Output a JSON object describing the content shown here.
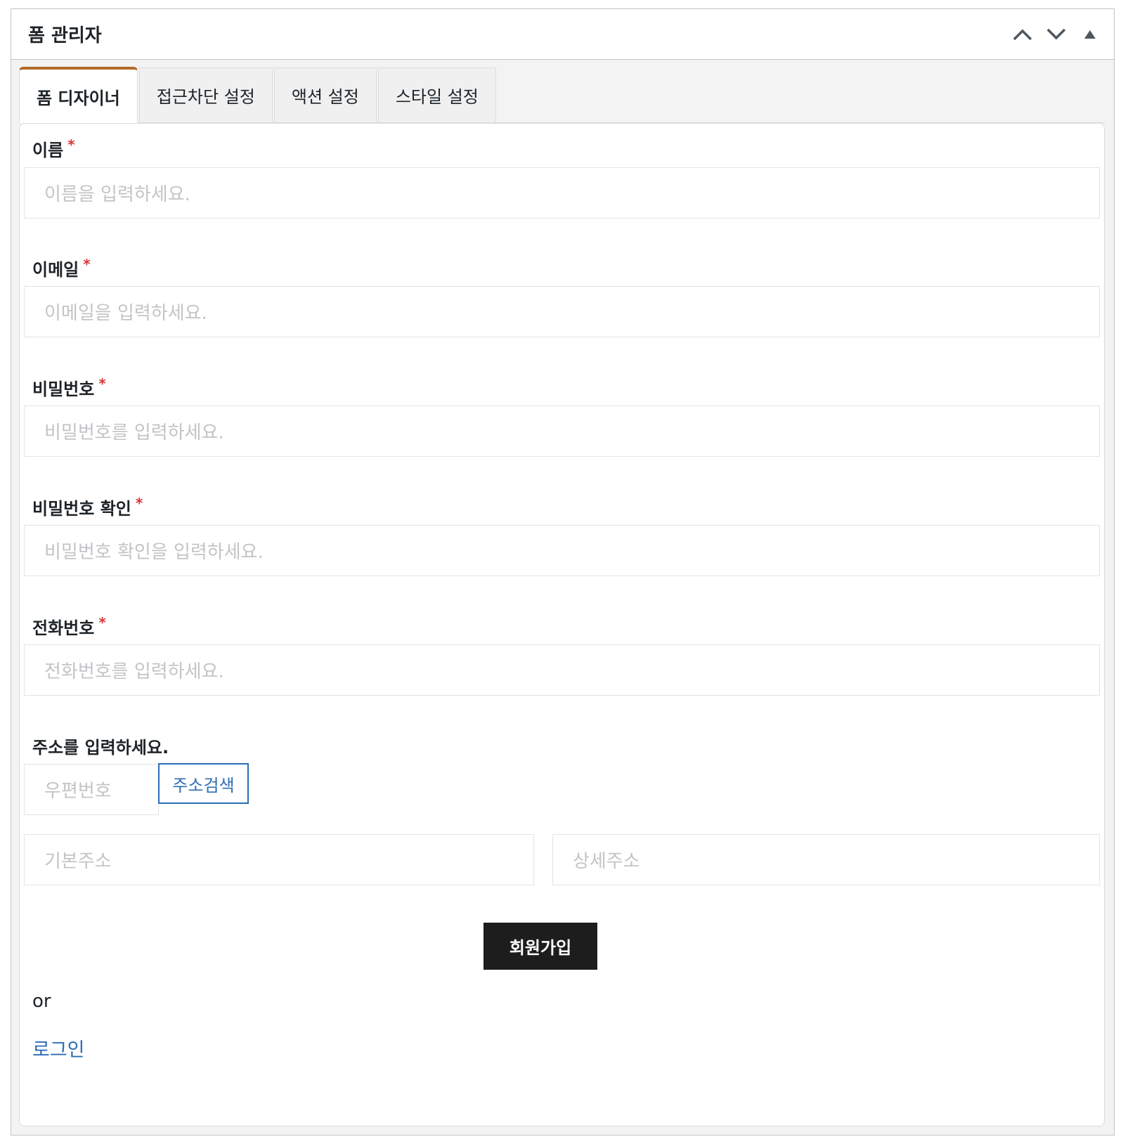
{
  "panel": {
    "title": "폼 관리자",
    "controls": [
      "chevron-up-icon",
      "chevron-down-icon",
      "triangle-up-icon"
    ]
  },
  "tabs": [
    {
      "label": "폼 디자이너",
      "active": true
    },
    {
      "label": "접근차단 설정",
      "active": false
    },
    {
      "label": "액션 설정",
      "active": false
    },
    {
      "label": "스타일 설정",
      "active": false
    }
  ],
  "form": {
    "fields": [
      {
        "label": "이름",
        "required": "*",
        "placeholder": "이름을 입력하세요."
      },
      {
        "label": "이메일",
        "required": "*",
        "placeholder": "이메일을 입력하세요."
      },
      {
        "label": "비밀번호",
        "required": "*",
        "placeholder": "비밀번호를 입력하세요."
      },
      {
        "label": "비밀번호 확인",
        "required": "*",
        "placeholder": "비밀번호 확인을 입력하세요."
      },
      {
        "label": "전화번호",
        "required": "*",
        "placeholder": "전화번호를 입력하세요."
      }
    ],
    "address": {
      "label": "주소를 입력하세요.",
      "zip_placeholder": "우편번호",
      "search_button": "주소검색",
      "base_placeholder": "기본주소",
      "detail_placeholder": "상세주소"
    },
    "submit_label": "회원가입",
    "or_text": "or",
    "login_link": "로그인"
  },
  "colors": {
    "accent_tab": "#b26a28",
    "link": "#2d6db5",
    "required": "#d63638",
    "submit_bg": "#1d1d1d"
  }
}
